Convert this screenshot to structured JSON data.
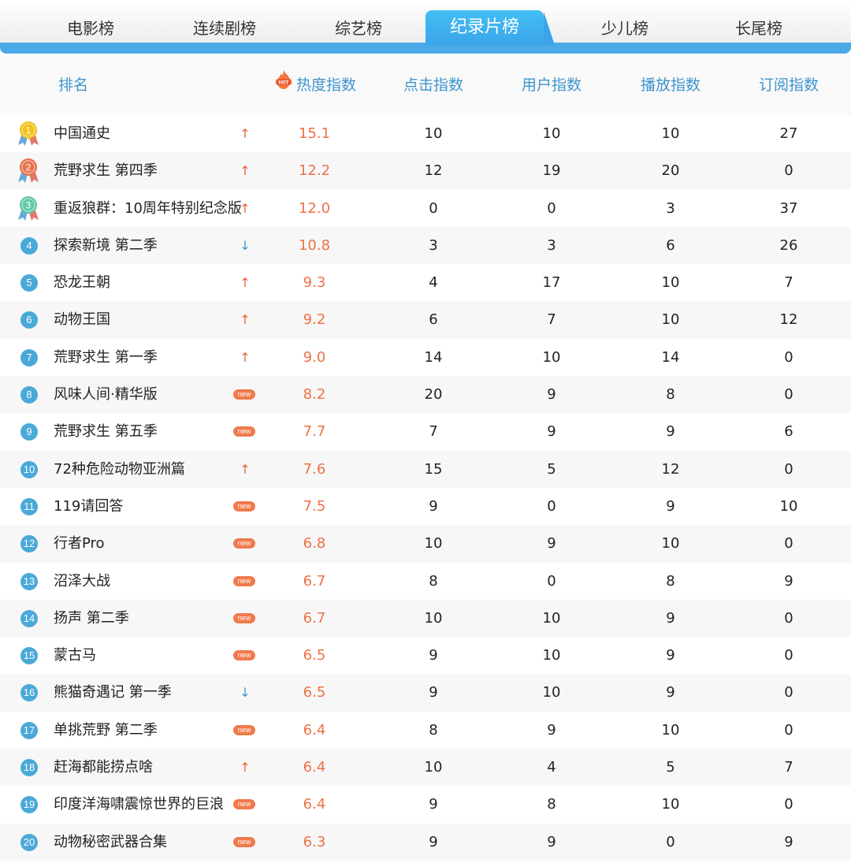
{
  "tabs": [
    {
      "label": "电影榜",
      "active": false
    },
    {
      "label": "连续剧榜",
      "active": false
    },
    {
      "label": "综艺榜",
      "active": false
    },
    {
      "label": "纪录片榜",
      "active": true
    },
    {
      "label": "少儿榜",
      "active": false
    },
    {
      "label": "长尾榜",
      "active": false
    }
  ],
  "header": {
    "rank": "排名",
    "hot_badge": "HOT",
    "heat": "热度指数",
    "click": "点击指数",
    "user": "用户指数",
    "play": "播放指数",
    "subscribe": "订阅指数"
  },
  "colors": {
    "accent": "#4aa9e6",
    "heat": "#ee7045",
    "up": "#e8633a",
    "down": "#3d94cd",
    "gold": "#f2c21b",
    "silver_red": "#e8734f",
    "bronze_green": "#5ec9a6"
  },
  "rows": [
    {
      "rank": "1",
      "title": "中国通史",
      "trend": "up",
      "heat": "15.1",
      "click": "10",
      "user": "10",
      "play": "10",
      "subscribe": "27"
    },
    {
      "rank": "2",
      "title": "荒野求生 第四季",
      "trend": "up",
      "heat": "12.2",
      "click": "12",
      "user": "19",
      "play": "20",
      "subscribe": "0"
    },
    {
      "rank": "3",
      "title": "重返狼群：10周年特别纪念版",
      "trend": "up",
      "heat": "12.0",
      "click": "0",
      "user": "0",
      "play": "3",
      "subscribe": "37"
    },
    {
      "rank": "4",
      "title": "探索新境 第二季",
      "trend": "down",
      "heat": "10.8",
      "click": "3",
      "user": "3",
      "play": "6",
      "subscribe": "26"
    },
    {
      "rank": "5",
      "title": "恐龙王朝",
      "trend": "up",
      "heat": "9.3",
      "click": "4",
      "user": "17",
      "play": "10",
      "subscribe": "7"
    },
    {
      "rank": "6",
      "title": "动物王国",
      "trend": "up",
      "heat": "9.2",
      "click": "6",
      "user": "7",
      "play": "10",
      "subscribe": "12"
    },
    {
      "rank": "7",
      "title": "荒野求生 第一季",
      "trend": "up",
      "heat": "9.0",
      "click": "14",
      "user": "10",
      "play": "14",
      "subscribe": "0"
    },
    {
      "rank": "8",
      "title": "风味人间·精华版",
      "trend": "new",
      "heat": "8.2",
      "click": "20",
      "user": "9",
      "play": "8",
      "subscribe": "0"
    },
    {
      "rank": "9",
      "title": "荒野求生 第五季",
      "trend": "new",
      "heat": "7.7",
      "click": "7",
      "user": "9",
      "play": "9",
      "subscribe": "6"
    },
    {
      "rank": "10",
      "title": "72种危险动物亚洲篇",
      "trend": "up",
      "heat": "7.6",
      "click": "15",
      "user": "5",
      "play": "12",
      "subscribe": "0"
    },
    {
      "rank": "11",
      "title": "119请回答",
      "trend": "new",
      "heat": "7.5",
      "click": "9",
      "user": "0",
      "play": "9",
      "subscribe": "10"
    },
    {
      "rank": "12",
      "title": "行者Pro",
      "trend": "new",
      "heat": "6.8",
      "click": "10",
      "user": "9",
      "play": "10",
      "subscribe": "0"
    },
    {
      "rank": "13",
      "title": "沼泽大战",
      "trend": "new",
      "heat": "6.7",
      "click": "8",
      "user": "0",
      "play": "8",
      "subscribe": "9"
    },
    {
      "rank": "14",
      "title": "扬声 第二季",
      "trend": "new",
      "heat": "6.7",
      "click": "10",
      "user": "10",
      "play": "9",
      "subscribe": "0"
    },
    {
      "rank": "15",
      "title": "蒙古马",
      "trend": "new",
      "heat": "6.5",
      "click": "9",
      "user": "10",
      "play": "9",
      "subscribe": "0"
    },
    {
      "rank": "16",
      "title": "熊猫奇遇记 第一季",
      "trend": "down",
      "heat": "6.5",
      "click": "9",
      "user": "10",
      "play": "9",
      "subscribe": "0"
    },
    {
      "rank": "17",
      "title": "单挑荒野 第二季",
      "trend": "new",
      "heat": "6.4",
      "click": "8",
      "user": "9",
      "play": "10",
      "subscribe": "0"
    },
    {
      "rank": "18",
      "title": "赶海都能捞点啥",
      "trend": "up",
      "heat": "6.4",
      "click": "10",
      "user": "4",
      "play": "5",
      "subscribe": "7"
    },
    {
      "rank": "19",
      "title": "印度洋海啸震惊世界的巨浪",
      "trend": "new",
      "heat": "6.4",
      "click": "9",
      "user": "8",
      "play": "10",
      "subscribe": "0"
    },
    {
      "rank": "20",
      "title": "动物秘密武器合集",
      "trend": "new",
      "heat": "6.3",
      "click": "9",
      "user": "9",
      "play": "0",
      "subscribe": "9"
    }
  ],
  "symbols": {
    "up": "↑",
    "down": "↓",
    "new": "new"
  }
}
